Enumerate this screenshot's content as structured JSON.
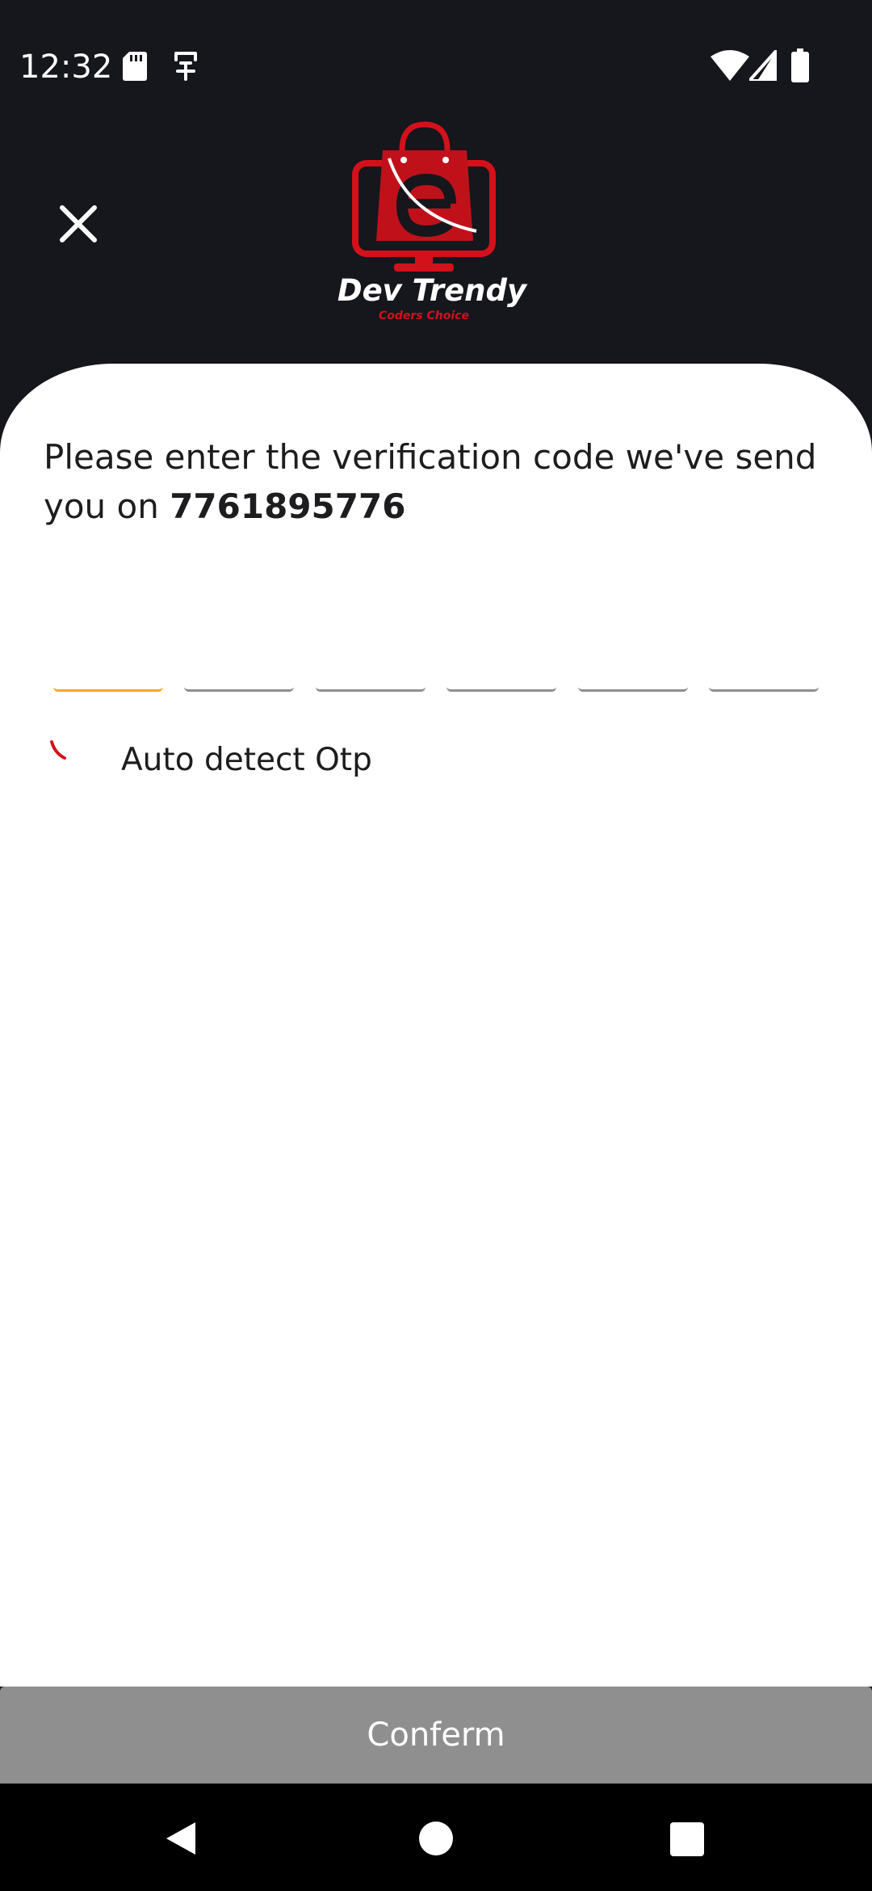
{
  "status_bar": {
    "time": "12:32",
    "left_icons": [
      "sd-card-icon",
      "accessibility-icon"
    ],
    "right_icons": [
      "wifi-icon",
      "signal-icon",
      "battery-icon"
    ]
  },
  "header": {
    "close_icon": "close-icon",
    "logo_title": "Dev Trendy",
    "logo_tagline": "Coders Choice",
    "brand_color": "#d3111a"
  },
  "verification": {
    "prompt_text": "Please enter the verification code we've send you on ",
    "phone_number": "7761895776",
    "otp_digit_count": 6,
    "otp_values": [
      "",
      "",
      "",
      "",
      "",
      ""
    ],
    "active_color": "#f4a91c",
    "auto_detect_label": "Auto detect Otp"
  },
  "actions": {
    "confirm_label": "Conferm",
    "button_color": "#8f8f8f"
  },
  "nav_bar": {
    "icons": [
      "back-icon",
      "home-icon",
      "recents-icon"
    ]
  }
}
